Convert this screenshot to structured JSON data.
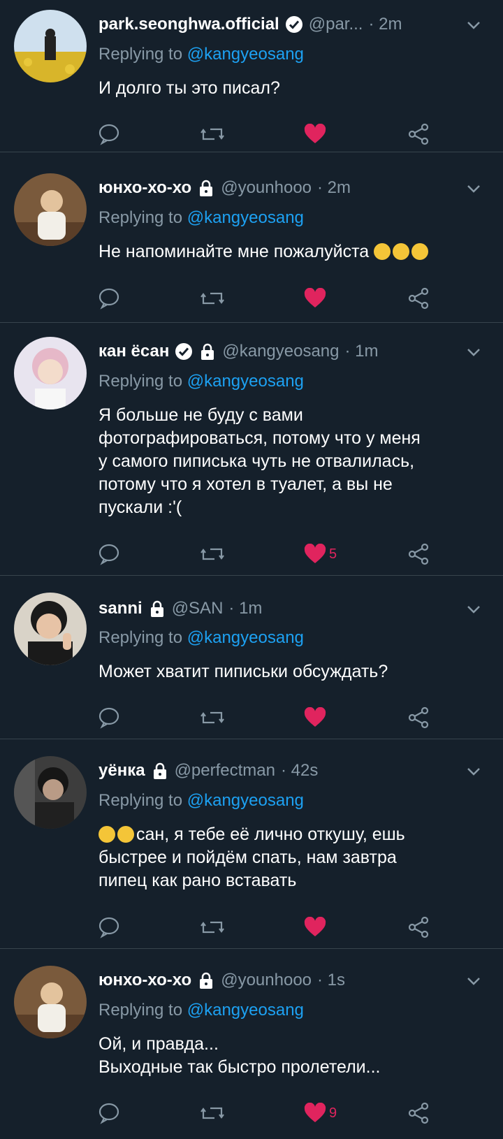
{
  "reply_prefix": "Replying to",
  "colors": {
    "background": "#15202b",
    "link": "#1da1f2",
    "muted": "#8899a6",
    "like": "#e0245e",
    "divider": "#38444d"
  },
  "tweets": [
    {
      "name": "park.seonghwa.official",
      "handle": "@par...",
      "time": "· 2m",
      "reply_to": "@kangyeosang",
      "text_lines": [
        "И долго ты это писал?"
      ],
      "verified": true,
      "locked": false,
      "liked": true,
      "like_count": "",
      "emoji": []
    },
    {
      "name": "юнхо-хо-хо",
      "handle": "@younhooo",
      "time": "· 2m",
      "reply_to": "@kangyeosang",
      "text_lines": [
        "Не напоминайте мне пожалуйста"
      ],
      "verified": false,
      "locked": true,
      "liked": true,
      "like_count": "",
      "emoji": [
        "rofl-emoji",
        "rofl-emoji",
        "rofl-emoji"
      ]
    },
    {
      "name": "кан ёсан",
      "handle": "@kangyeosang",
      "time": "· 1m",
      "reply_to": "@kangyeosang",
      "text_lines": [
        "Я больше не буду с вами",
        "фотографироваться, потому что у меня",
        "у самого пиписька чуть не отвалилась,",
        "потому что я хотел в туалет, а вы не",
        "пускали :'("
      ],
      "verified": true,
      "locked": true,
      "liked": true,
      "like_count": "5",
      "emoji": []
    },
    {
      "name": "sanni",
      "handle": "@SAN",
      "time": "· 1m",
      "reply_to": "@kangyeosang",
      "text_lines": [
        "Может хватит пиписьки обсуждать?"
      ],
      "verified": false,
      "locked": true,
      "liked": true,
      "like_count": "",
      "emoji": []
    },
    {
      "name": "уёнка",
      "handle": "@perfectman",
      "time": "· 42s",
      "reply_to": "@kangyeosang",
      "text_lines": [
        "сан, я тебе её лично откушу, ешь",
        "быстрее и пойдём спать, нам завтра",
        "пипец как рано вставать"
      ],
      "verified": false,
      "locked": true,
      "liked": true,
      "like_count": "",
      "emoji": [
        "bandage-face-emoji",
        "eye-roll-emoji"
      ]
    },
    {
      "name": "юнхо-хо-хо",
      "handle": "@younhooo",
      "time": "· 1s",
      "reply_to": "@kangyeosang",
      "text_lines": [
        "Ой, и правда...",
        "Выходные так быстро пролетели..."
      ],
      "verified": false,
      "locked": true,
      "liked": true,
      "like_count": "9",
      "emoji": []
    }
  ]
}
